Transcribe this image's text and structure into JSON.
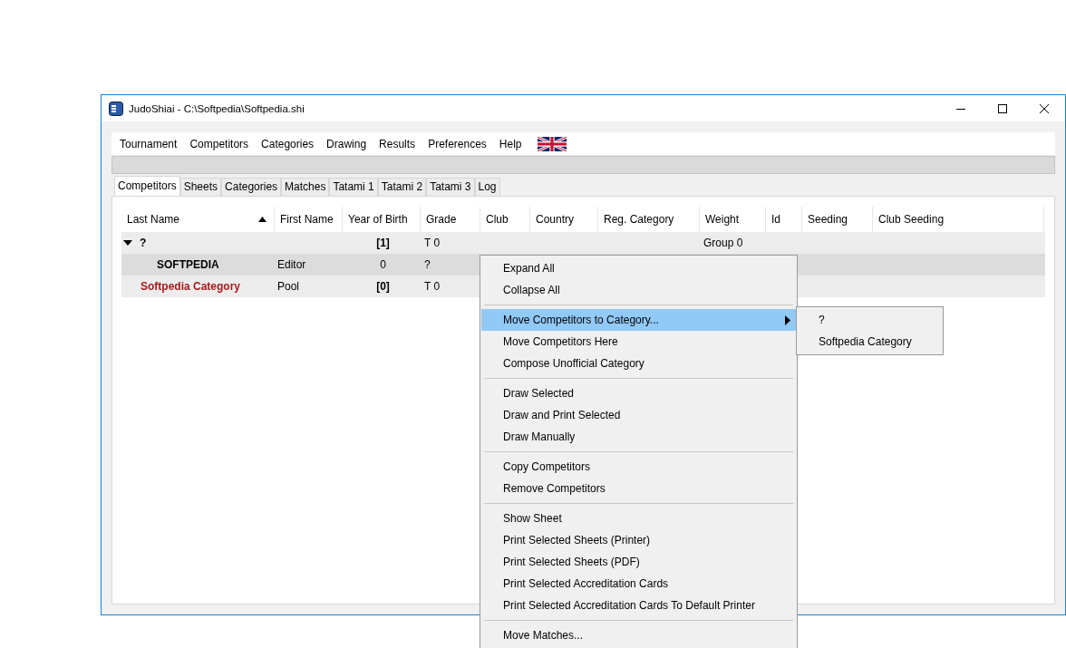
{
  "window": {
    "title": "JudoShiai - C:\\Softpedia\\Softpedia.shi"
  },
  "menu_bar": [
    "Tournament",
    "Competitors",
    "Categories",
    "Drawing",
    "Results",
    "Preferences",
    "Help"
  ],
  "tabs": [
    {
      "label": "Competitors",
      "selected": true
    },
    {
      "label": "Sheets",
      "selected": false
    },
    {
      "label": "Categories",
      "selected": false
    },
    {
      "label": "Matches",
      "selected": false
    },
    {
      "label": "Tatami 1",
      "selected": false
    },
    {
      "label": "Tatami 2",
      "selected": false
    },
    {
      "label": "Tatami 3",
      "selected": false
    },
    {
      "label": "Log",
      "selected": false
    }
  ],
  "progress": {
    "level": 0
  },
  "table": {
    "columns": [
      {
        "label": "Last Name",
        "sorted": true
      },
      {
        "label": "First Name",
        "sorted": false
      },
      {
        "label": "Year of Birth",
        "sorted": false
      },
      {
        "label": "Grade",
        "sorted": false
      },
      {
        "label": "Club",
        "sorted": false
      },
      {
        "label": "Country",
        "sorted": false
      },
      {
        "label": "Reg. Category",
        "sorted": false
      },
      {
        "label": "Weight",
        "sorted": false
      },
      {
        "label": "Id",
        "sorted": false
      },
      {
        "label": "Seeding",
        "sorted": false
      },
      {
        "label": "Club Seeding",
        "sorted": false
      }
    ],
    "rows": [
      {
        "kind": "group",
        "expanded": true,
        "selected": false,
        "last_name": "?",
        "year_of_birth": "[1]",
        "grade": "T 0",
        "weight": "Group 0"
      },
      {
        "kind": "competitor",
        "selected": true,
        "last_name": "SOFTPEDIA",
        "first_name": "Editor",
        "year_of_birth": "0",
        "grade": "?"
      },
      {
        "kind": "category",
        "selected": false,
        "last_name": "Softpedia Category",
        "first_name": "Pool",
        "year_of_birth": "[0]",
        "grade": "T 0"
      }
    ]
  },
  "context_menu": {
    "sections": [
      [
        {
          "label": "Expand All",
          "kind": "action",
          "highlighted": false
        },
        {
          "label": "Collapse All",
          "kind": "action",
          "highlighted": false
        }
      ],
      [
        {
          "label": "Move Competitors to Category...",
          "kind": "submenu",
          "highlighted": true
        },
        {
          "label": "Move Competitors Here",
          "kind": "action",
          "highlighted": false
        },
        {
          "label": "Compose Unofficial Category",
          "kind": "action",
          "highlighted": false
        }
      ],
      [
        {
          "label": "Draw Selected",
          "kind": "action",
          "highlighted": false
        },
        {
          "label": "Draw and Print Selected",
          "kind": "action",
          "highlighted": false
        },
        {
          "label": "Draw Manually",
          "kind": "action",
          "highlighted": false
        }
      ],
      [
        {
          "label": "Copy Competitors",
          "kind": "action",
          "highlighted": false
        },
        {
          "label": "Remove Competitors",
          "kind": "action",
          "highlighted": false
        }
      ],
      [
        {
          "label": "Show Sheet",
          "kind": "action",
          "highlighted": false
        },
        {
          "label": "Print Selected Sheets (Printer)",
          "kind": "action",
          "highlighted": false
        },
        {
          "label": "Print Selected Sheets (PDF)",
          "kind": "action",
          "highlighted": false
        },
        {
          "label": "Print Selected Accreditation Cards",
          "kind": "action",
          "highlighted": false
        },
        {
          "label": "Print Selected Accreditation Cards To Default Printer",
          "kind": "action",
          "highlighted": false
        }
      ],
      [
        {
          "label": "Move Matches...",
          "kind": "action",
          "highlighted": false
        }
      ]
    ],
    "submenu": [
      "?",
      "Softpedia Category"
    ]
  }
}
